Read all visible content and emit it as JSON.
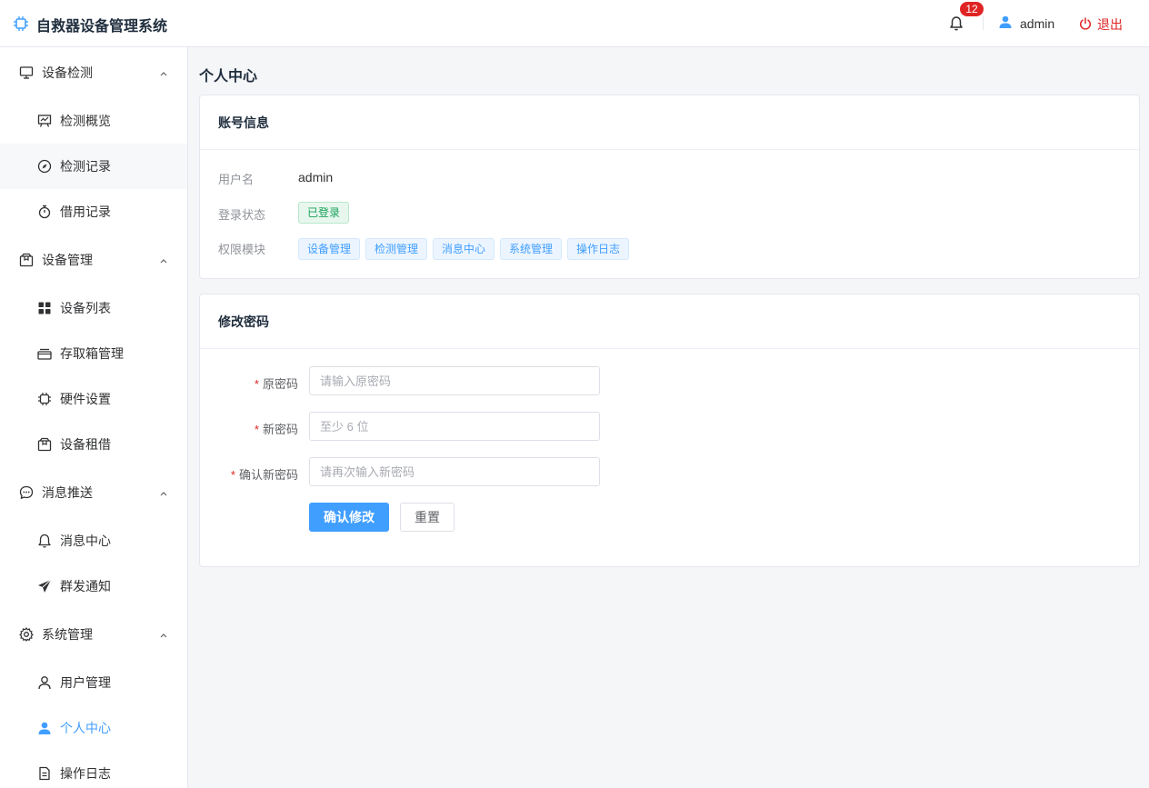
{
  "header": {
    "app_title": "自救器设备管理系统",
    "notification_count": "12",
    "username": "admin",
    "logout_label": "退出"
  },
  "colors": {
    "accent": "#409eff",
    "danger": "#e02424",
    "success": "#18a058"
  },
  "sidebar": {
    "groups": [
      {
        "label": "设备检测",
        "icon": "monitor-icon",
        "items": [
          {
            "label": "检测概览",
            "icon": "chart-board-icon"
          },
          {
            "label": "检测记录",
            "icon": "compass-icon"
          },
          {
            "label": "借用记录",
            "icon": "stopwatch-icon"
          }
        ]
      },
      {
        "label": "设备管理",
        "icon": "box-icon",
        "items": [
          {
            "label": "设备列表",
            "icon": "grid-icon"
          },
          {
            "label": "存取箱管理",
            "icon": "tray-icon"
          },
          {
            "label": "硬件设置",
            "icon": "chip-icon"
          },
          {
            "label": "设备租借",
            "icon": "package-icon"
          }
        ]
      },
      {
        "label": "消息推送",
        "icon": "chat-icon",
        "items": [
          {
            "label": "消息中心",
            "icon": "bell-icon"
          },
          {
            "label": "群发通知",
            "icon": "send-icon"
          }
        ]
      },
      {
        "label": "系统管理",
        "icon": "gear-icon",
        "items": [
          {
            "label": "用户管理",
            "icon": "user-outline-icon"
          },
          {
            "label": "个人中心",
            "icon": "user-filled-icon",
            "active": true
          },
          {
            "label": "操作日志",
            "icon": "document-icon"
          }
        ]
      }
    ]
  },
  "main": {
    "page_title": "个人中心",
    "account_card": {
      "title": "账号信息",
      "username_label": "用户名",
      "username_value": "admin",
      "status_label": "登录状态",
      "status_value": "已登录",
      "perm_label": "权限模块",
      "permissions": [
        "设备管理",
        "检测管理",
        "消息中心",
        "系统管理",
        "操作日志"
      ]
    },
    "password_card": {
      "title": "修改密码",
      "old_label": "原密码",
      "old_placeholder": "请输入原密码",
      "new_label": "新密码",
      "new_placeholder": "至少 6 位",
      "confirm_label": "确认新密码",
      "confirm_placeholder": "请再次输入新密码",
      "submit_label": "确认修改",
      "reset_label": "重置",
      "required_mark": "*"
    }
  }
}
